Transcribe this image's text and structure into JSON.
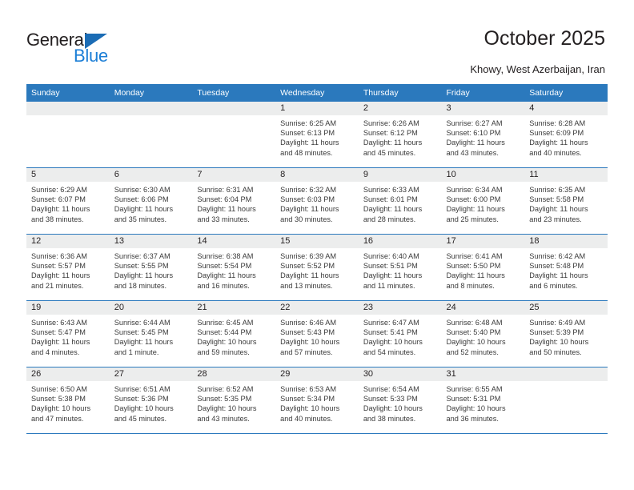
{
  "brand": {
    "name_top": "General",
    "name_bottom": "Blue",
    "accent_color": "#1b7ed6",
    "triangle_color": "#1b6cb5",
    "triangle_icon": "triangle-icon"
  },
  "header": {
    "title": "October 2025",
    "subtitle": "Khowy, West Azerbaijan, Iran"
  },
  "calendar": {
    "header_bg": "#2b79bd",
    "header_text_color": "#ffffff",
    "daynum_band_bg": "#eceded",
    "weekday_headers": [
      "Sunday",
      "Monday",
      "Tuesday",
      "Wednesday",
      "Thursday",
      "Friday",
      "Saturday"
    ],
    "weeks": [
      [
        {
          "empty": true
        },
        {
          "empty": true
        },
        {
          "empty": true
        },
        {
          "day": "1",
          "sunrise": "Sunrise: 6:25 AM",
          "sunset": "Sunset: 6:13 PM",
          "daylight1": "Daylight: 11 hours",
          "daylight2": "and 48 minutes."
        },
        {
          "day": "2",
          "sunrise": "Sunrise: 6:26 AM",
          "sunset": "Sunset: 6:12 PM",
          "daylight1": "Daylight: 11 hours",
          "daylight2": "and 45 minutes."
        },
        {
          "day": "3",
          "sunrise": "Sunrise: 6:27 AM",
          "sunset": "Sunset: 6:10 PM",
          "daylight1": "Daylight: 11 hours",
          "daylight2": "and 43 minutes."
        },
        {
          "day": "4",
          "sunrise": "Sunrise: 6:28 AM",
          "sunset": "Sunset: 6:09 PM",
          "daylight1": "Daylight: 11 hours",
          "daylight2": "and 40 minutes."
        }
      ],
      [
        {
          "day": "5",
          "sunrise": "Sunrise: 6:29 AM",
          "sunset": "Sunset: 6:07 PM",
          "daylight1": "Daylight: 11 hours",
          "daylight2": "and 38 minutes."
        },
        {
          "day": "6",
          "sunrise": "Sunrise: 6:30 AM",
          "sunset": "Sunset: 6:06 PM",
          "daylight1": "Daylight: 11 hours",
          "daylight2": "and 35 minutes."
        },
        {
          "day": "7",
          "sunrise": "Sunrise: 6:31 AM",
          "sunset": "Sunset: 6:04 PM",
          "daylight1": "Daylight: 11 hours",
          "daylight2": "and 33 minutes."
        },
        {
          "day": "8",
          "sunrise": "Sunrise: 6:32 AM",
          "sunset": "Sunset: 6:03 PM",
          "daylight1": "Daylight: 11 hours",
          "daylight2": "and 30 minutes."
        },
        {
          "day": "9",
          "sunrise": "Sunrise: 6:33 AM",
          "sunset": "Sunset: 6:01 PM",
          "daylight1": "Daylight: 11 hours",
          "daylight2": "and 28 minutes."
        },
        {
          "day": "10",
          "sunrise": "Sunrise: 6:34 AM",
          "sunset": "Sunset: 6:00 PM",
          "daylight1": "Daylight: 11 hours",
          "daylight2": "and 25 minutes."
        },
        {
          "day": "11",
          "sunrise": "Sunrise: 6:35 AM",
          "sunset": "Sunset: 5:58 PM",
          "daylight1": "Daylight: 11 hours",
          "daylight2": "and 23 minutes."
        }
      ],
      [
        {
          "day": "12",
          "sunrise": "Sunrise: 6:36 AM",
          "sunset": "Sunset: 5:57 PM",
          "daylight1": "Daylight: 11 hours",
          "daylight2": "and 21 minutes."
        },
        {
          "day": "13",
          "sunrise": "Sunrise: 6:37 AM",
          "sunset": "Sunset: 5:55 PM",
          "daylight1": "Daylight: 11 hours",
          "daylight2": "and 18 minutes."
        },
        {
          "day": "14",
          "sunrise": "Sunrise: 6:38 AM",
          "sunset": "Sunset: 5:54 PM",
          "daylight1": "Daylight: 11 hours",
          "daylight2": "and 16 minutes."
        },
        {
          "day": "15",
          "sunrise": "Sunrise: 6:39 AM",
          "sunset": "Sunset: 5:52 PM",
          "daylight1": "Daylight: 11 hours",
          "daylight2": "and 13 minutes."
        },
        {
          "day": "16",
          "sunrise": "Sunrise: 6:40 AM",
          "sunset": "Sunset: 5:51 PM",
          "daylight1": "Daylight: 11 hours",
          "daylight2": "and 11 minutes."
        },
        {
          "day": "17",
          "sunrise": "Sunrise: 6:41 AM",
          "sunset": "Sunset: 5:50 PM",
          "daylight1": "Daylight: 11 hours",
          "daylight2": "and 8 minutes."
        },
        {
          "day": "18",
          "sunrise": "Sunrise: 6:42 AM",
          "sunset": "Sunset: 5:48 PM",
          "daylight1": "Daylight: 11 hours",
          "daylight2": "and 6 minutes."
        }
      ],
      [
        {
          "day": "19",
          "sunrise": "Sunrise: 6:43 AM",
          "sunset": "Sunset: 5:47 PM",
          "daylight1": "Daylight: 11 hours",
          "daylight2": "and 4 minutes."
        },
        {
          "day": "20",
          "sunrise": "Sunrise: 6:44 AM",
          "sunset": "Sunset: 5:45 PM",
          "daylight1": "Daylight: 11 hours",
          "daylight2": "and 1 minute."
        },
        {
          "day": "21",
          "sunrise": "Sunrise: 6:45 AM",
          "sunset": "Sunset: 5:44 PM",
          "daylight1": "Daylight: 10 hours",
          "daylight2": "and 59 minutes."
        },
        {
          "day": "22",
          "sunrise": "Sunrise: 6:46 AM",
          "sunset": "Sunset: 5:43 PM",
          "daylight1": "Daylight: 10 hours",
          "daylight2": "and 57 minutes."
        },
        {
          "day": "23",
          "sunrise": "Sunrise: 6:47 AM",
          "sunset": "Sunset: 5:41 PM",
          "daylight1": "Daylight: 10 hours",
          "daylight2": "and 54 minutes."
        },
        {
          "day": "24",
          "sunrise": "Sunrise: 6:48 AM",
          "sunset": "Sunset: 5:40 PM",
          "daylight1": "Daylight: 10 hours",
          "daylight2": "and 52 minutes."
        },
        {
          "day": "25",
          "sunrise": "Sunrise: 6:49 AM",
          "sunset": "Sunset: 5:39 PM",
          "daylight1": "Daylight: 10 hours",
          "daylight2": "and 50 minutes."
        }
      ],
      [
        {
          "day": "26",
          "sunrise": "Sunrise: 6:50 AM",
          "sunset": "Sunset: 5:38 PM",
          "daylight1": "Daylight: 10 hours",
          "daylight2": "and 47 minutes."
        },
        {
          "day": "27",
          "sunrise": "Sunrise: 6:51 AM",
          "sunset": "Sunset: 5:36 PM",
          "daylight1": "Daylight: 10 hours",
          "daylight2": "and 45 minutes."
        },
        {
          "day": "28",
          "sunrise": "Sunrise: 6:52 AM",
          "sunset": "Sunset: 5:35 PM",
          "daylight1": "Daylight: 10 hours",
          "daylight2": "and 43 minutes."
        },
        {
          "day": "29",
          "sunrise": "Sunrise: 6:53 AM",
          "sunset": "Sunset: 5:34 PM",
          "daylight1": "Daylight: 10 hours",
          "daylight2": "and 40 minutes."
        },
        {
          "day": "30",
          "sunrise": "Sunrise: 6:54 AM",
          "sunset": "Sunset: 5:33 PM",
          "daylight1": "Daylight: 10 hours",
          "daylight2": "and 38 minutes."
        },
        {
          "day": "31",
          "sunrise": "Sunrise: 6:55 AM",
          "sunset": "Sunset: 5:31 PM",
          "daylight1": "Daylight: 10 hours",
          "daylight2": "and 36 minutes."
        },
        {
          "empty": true
        }
      ]
    ]
  }
}
